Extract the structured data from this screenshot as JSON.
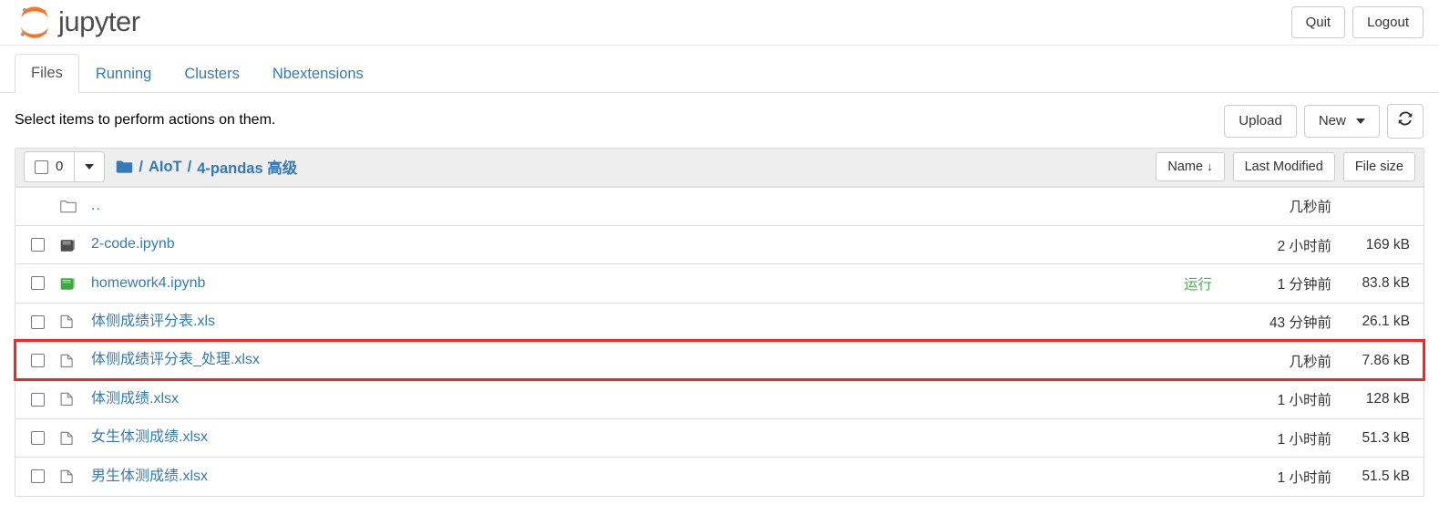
{
  "header": {
    "brand": "jupyter",
    "logo_icon": "jupyter-logo",
    "quit_label": "Quit",
    "logout_label": "Logout"
  },
  "tabs": [
    {
      "label": "Files",
      "active": true
    },
    {
      "label": "Running",
      "active": false
    },
    {
      "label": "Clusters",
      "active": false
    },
    {
      "label": "Nbextensions",
      "active": false
    }
  ],
  "action_bar": {
    "hint": "Select items to perform actions on them.",
    "upload_label": "Upload",
    "new_label": "New",
    "new_caret_icon": "chevron-down-icon",
    "refresh_icon": "refresh-icon"
  },
  "list_header": {
    "selected_count": "0",
    "select_all_checkbox_icon": "checkbox-icon",
    "dropdown_caret_icon": "chevron-down-icon",
    "breadcrumb_folder_icon": "folder-icon",
    "breadcrumb": [
      "AIoT",
      "4-pandas 高级"
    ],
    "breadcrumb_separator": "/",
    "sort_name": "Name",
    "sort_name_arrow": "↓",
    "sort_modified": "Last Modified",
    "sort_size": "File size"
  },
  "rows": [
    {
      "name": "..",
      "icon": "folder-open-icon",
      "type": "parent",
      "checkbox": false,
      "running": "",
      "modified": "几秒前",
      "size": ""
    },
    {
      "name": "2-code.ipynb",
      "icon": "notebook-icon",
      "type": "notebook",
      "checkbox": true,
      "running": "",
      "modified": "2 小时前",
      "size": "169 kB"
    },
    {
      "name": "homework4.ipynb",
      "icon": "notebook-running-icon",
      "type": "notebook-running",
      "checkbox": true,
      "running": "运行",
      "modified": "1 分钟前",
      "size": "83.8 kB"
    },
    {
      "name": "体侧成绩评分表.xls",
      "icon": "file-icon",
      "type": "file",
      "checkbox": true,
      "running": "",
      "modified": "43 分钟前",
      "size": "26.1 kB"
    },
    {
      "name": "体侧成绩评分表_处理.xlsx",
      "icon": "file-icon",
      "type": "file",
      "checkbox": true,
      "running": "",
      "modified": "几秒前",
      "size": "7.86 kB",
      "highlighted": true
    },
    {
      "name": "体测成绩.xlsx",
      "icon": "file-icon",
      "type": "file",
      "checkbox": true,
      "running": "",
      "modified": "1 小时前",
      "size": "128 kB"
    },
    {
      "name": "女生体测成绩.xlsx",
      "icon": "file-icon",
      "type": "file",
      "checkbox": true,
      "running": "",
      "modified": "1 小时前",
      "size": "51.3 kB"
    },
    {
      "name": "男生体测成绩.xlsx",
      "icon": "file-icon",
      "type": "file",
      "checkbox": true,
      "running": "",
      "modified": "1 小时前",
      "size": "51.5 kB"
    }
  ],
  "colors": {
    "link": "#337ab7",
    "running": "#4caf50",
    "highlight": "#fb2222",
    "brand_orange": "#f37726",
    "brand_gray": "#767677"
  }
}
